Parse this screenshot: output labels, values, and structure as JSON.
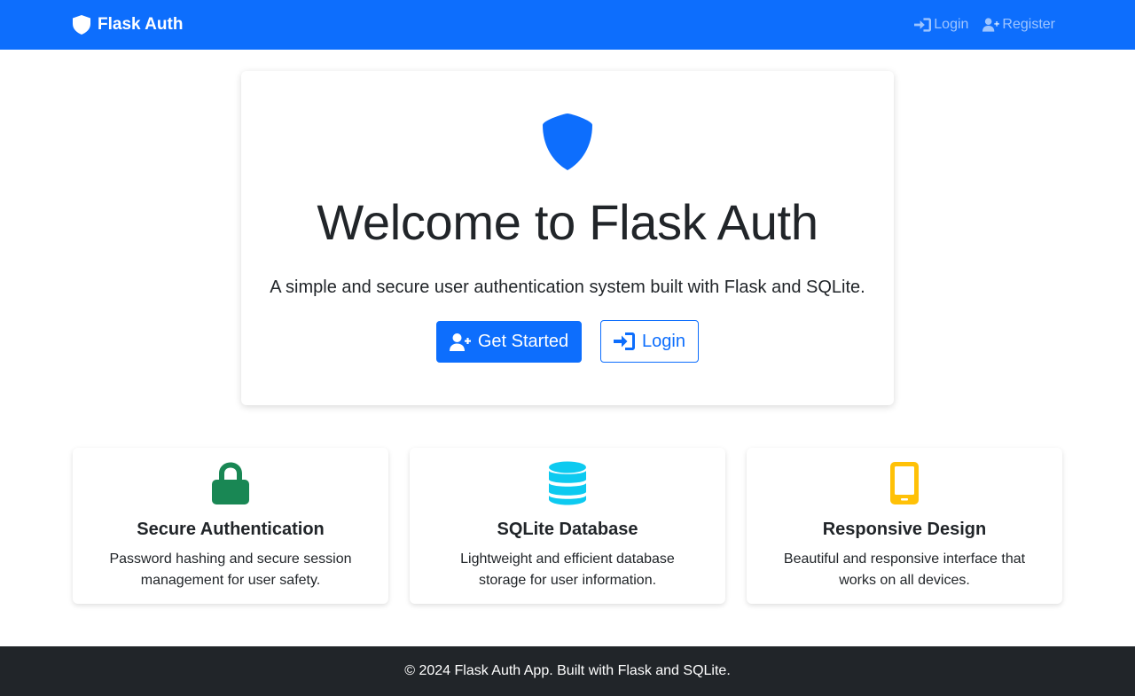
{
  "navbar": {
    "brand": "Flask Auth",
    "brand_icon": "shield-icon",
    "links": [
      {
        "label": "Login",
        "icon": "sign-in-icon"
      },
      {
        "label": "Register",
        "icon": "user-plus-icon"
      }
    ],
    "background": "#0d6efd"
  },
  "hero": {
    "icon": "shield-icon",
    "title": "Welcome to Flask Auth",
    "subtitle": "A simple and secure user authentication system built with Flask and SQLite.",
    "primary_button": {
      "label": "Get Started",
      "icon": "user-plus-icon"
    },
    "secondary_button": {
      "label": "Login",
      "icon": "sign-in-icon"
    }
  },
  "features": [
    {
      "title": "Secure Authentication",
      "description": "Password hashing and secure session management for user safety.",
      "icon": "lock-icon",
      "color": "#198754"
    },
    {
      "title": "SQLite Database",
      "description": "Lightweight and efficient database storage for user information.",
      "icon": "database-icon",
      "color": "#0dcaf0"
    },
    {
      "title": "Responsive Design",
      "description": "Beautiful and responsive interface that works on all devices.",
      "icon": "mobile-icon",
      "color": "#ffc107"
    }
  ],
  "footer": {
    "text": "© 2024 Flask Auth App. Built with Flask and SQLite.",
    "background": "#212529"
  }
}
